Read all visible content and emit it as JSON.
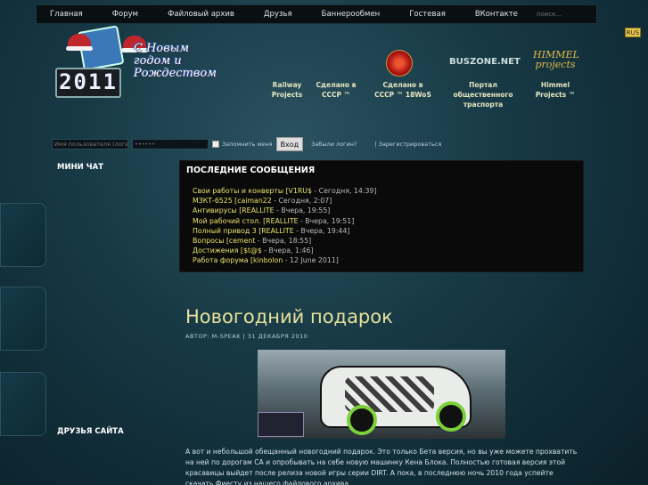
{
  "nav": {
    "items": [
      "Главная",
      "Форум",
      "Файловый архив",
      "Друзья",
      "Баннерообмен",
      "Гостевая",
      "ВКонтакте"
    ],
    "search_placeholder": "поиск..."
  },
  "lang_badge": "RUS",
  "logo": {
    "year": "2011",
    "greeting": "С Новым годом и Рождеством"
  },
  "partners": [
    {
      "label": "Railway Projects"
    },
    {
      "label": "Сделано в СССР ™"
    },
    {
      "label": "Сделано в СССР ™ 18WoS"
    },
    {
      "label": "Портал общественного траспорта"
    },
    {
      "label": "Himmel Projects ™"
    }
  ],
  "partner_logos": {
    "buszone": "BUSZONE.NET",
    "himmel": "HIMMEL projects"
  },
  "login": {
    "username_placeholder": "Имя пользователя (логин)",
    "password_value": "••••••",
    "remember_label": "Запомнить меня",
    "login_button": "Вход",
    "forgot_link": "Забыли логин?",
    "register_link": "| Зарегистрироваться"
  },
  "sidebar": {
    "minichat_title": "МИНИ ЧАТ",
    "friends_title": "ДРУЗЬЯ САЙТА"
  },
  "messages": {
    "title": "ПОСЛЕДНИЕ СООБЩЕНИЯ",
    "items": [
      {
        "topic": "Свои работы и конверты",
        "author": "[V1RU$",
        "when": " - Сегодня, 14:39]"
      },
      {
        "topic": "МЗКТ-6525",
        "author": "[caiman22",
        "when": " - Сегодня, 2:07]"
      },
      {
        "topic": "Антивирусы",
        "author": "[REALLITE",
        "when": " - Вчера, 19:55]"
      },
      {
        "topic": "Мой рабочий стол.",
        "author": "[REALLITE",
        "when": " - Вчера, 19:51]"
      },
      {
        "topic": "Полный привод 3",
        "author": "[REALLITE",
        "when": " - Вчера, 19:44]"
      },
      {
        "topic": "Вопросы",
        "author": "[cement",
        "when": " - Вчера, 18:55]"
      },
      {
        "topic": "Достижения",
        "author": "[$t@$",
        "when": " - Вчера, 1:46]"
      },
      {
        "topic": "Работа форума",
        "author": "[kinbolon",
        "when": " - 12 June 2011]"
      }
    ]
  },
  "article": {
    "title": "Новогодний подарок",
    "meta": "АВТОР: M-SPEAK | 31 ДЕКАБРЯ 2010",
    "body": "А вот и небольшой обещанный новогодний подарок. Это только Бета версия, но вы уже можете прохватить на ней по дорогам СА и опробывать на себе новую машинку Кена Блока. Полностью готовая версия этой красавицы выйдет после релиза новой игры серии DIRT. А пока, в последнюю ночь 2010 года успейте скачать Фиесту из нашего файлового архива."
  },
  "colors": {
    "accent_yellow": "#e8e26a",
    "background": "#163844",
    "panel": "#0a0a0a"
  }
}
